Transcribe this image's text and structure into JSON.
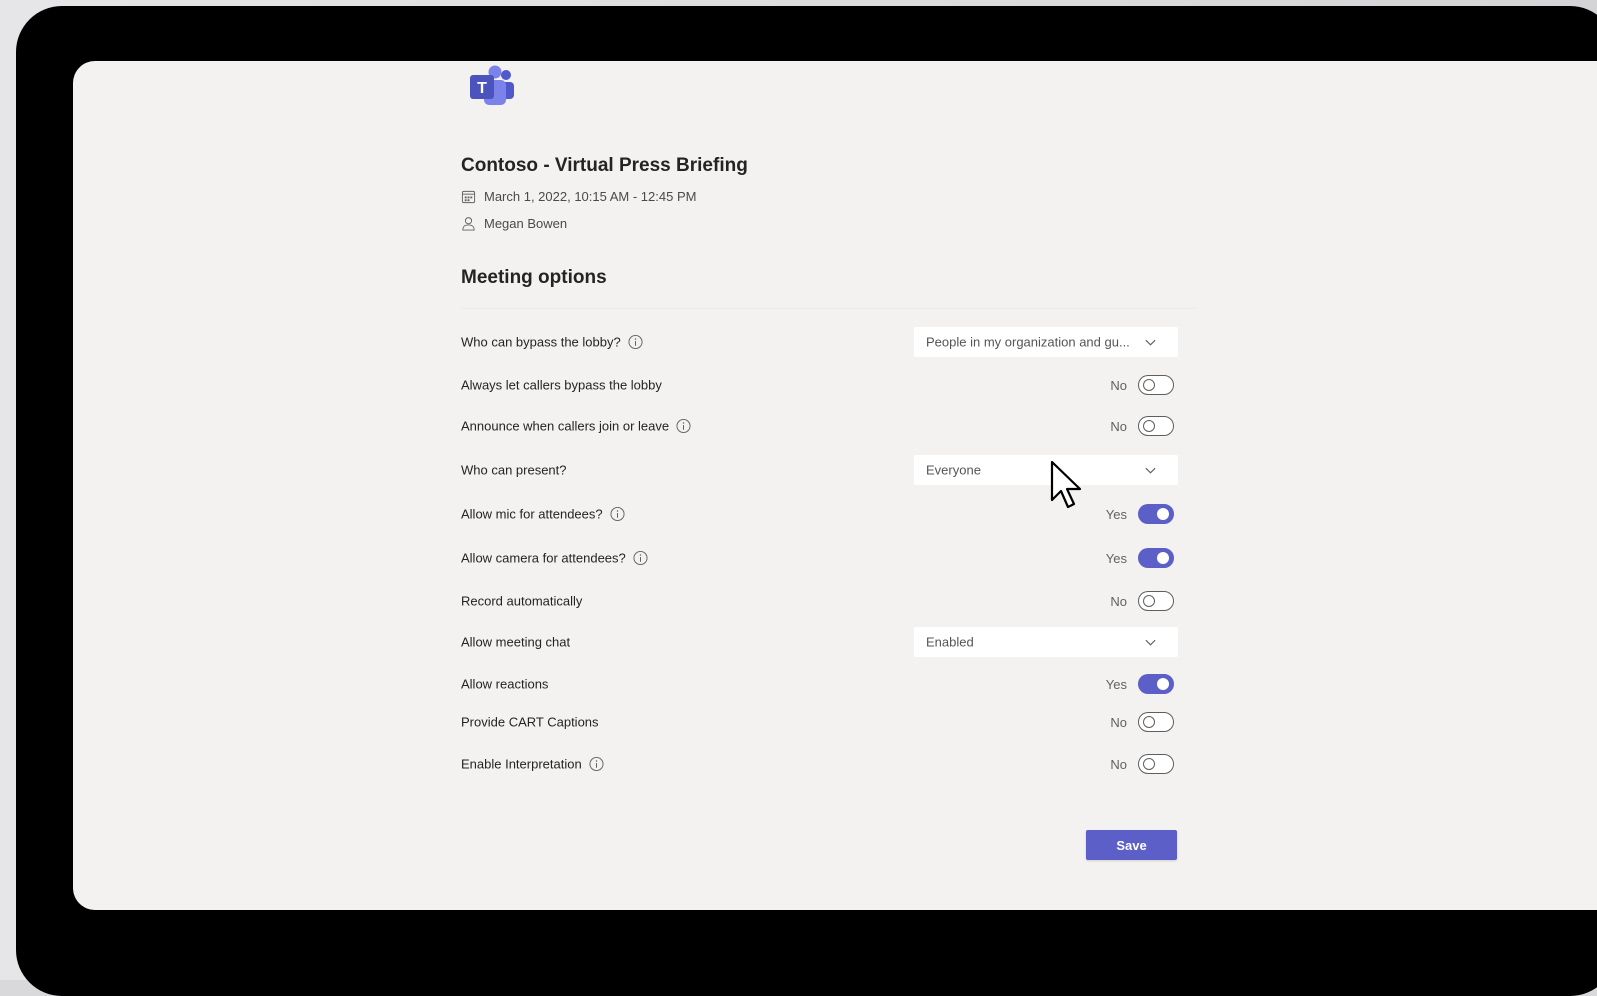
{
  "meeting": {
    "title": "Contoso - Virtual Press Briefing",
    "datetime": "March 1, 2022, 10:15 AM - 12:45 PM",
    "organizer": "Megan Bowen",
    "date_icon": "calendar-icon",
    "organizer_icon": "person-icon"
  },
  "app": {
    "logo": "teams-logo",
    "logo_letter": "T"
  },
  "options_section": {
    "title": "Meeting options",
    "items": [
      {
        "label": "Who can bypass the lobby?",
        "info": true,
        "control": "dropdown",
        "value": "People in my organization and gu..."
      },
      {
        "label": "Always let callers bypass the lobby",
        "info": false,
        "control": "toggle",
        "value": "No",
        "on": false
      },
      {
        "label": "Announce when callers join or leave",
        "info": true,
        "control": "toggle",
        "value": "No",
        "on": false
      },
      {
        "label": "Who can present?",
        "info": false,
        "control": "dropdown",
        "value": "Everyone"
      },
      {
        "label": "Allow mic for attendees?",
        "info": true,
        "control": "toggle",
        "value": "Yes",
        "on": true
      },
      {
        "label": "Allow camera for attendees?",
        "info": true,
        "control": "toggle",
        "value": "Yes",
        "on": true
      },
      {
        "label": "Record automatically",
        "info": false,
        "control": "toggle",
        "value": "No",
        "on": false
      },
      {
        "label": "Allow meeting chat",
        "info": false,
        "control": "dropdown",
        "value": "Enabled"
      },
      {
        "label": "Allow reactions",
        "info": false,
        "control": "toggle",
        "value": "Yes",
        "on": true
      },
      {
        "label": "Provide CART Captions",
        "info": false,
        "control": "toggle",
        "value": "No",
        "on": false
      },
      {
        "label": "Enable Interpretation",
        "info": true,
        "control": "toggle",
        "value": "No",
        "on": false
      }
    ]
  },
  "actions": {
    "save_label": "Save"
  },
  "colors": {
    "accent": "#5b5fc7",
    "page_background": "#f3f2f1",
    "frame": "#000000"
  }
}
